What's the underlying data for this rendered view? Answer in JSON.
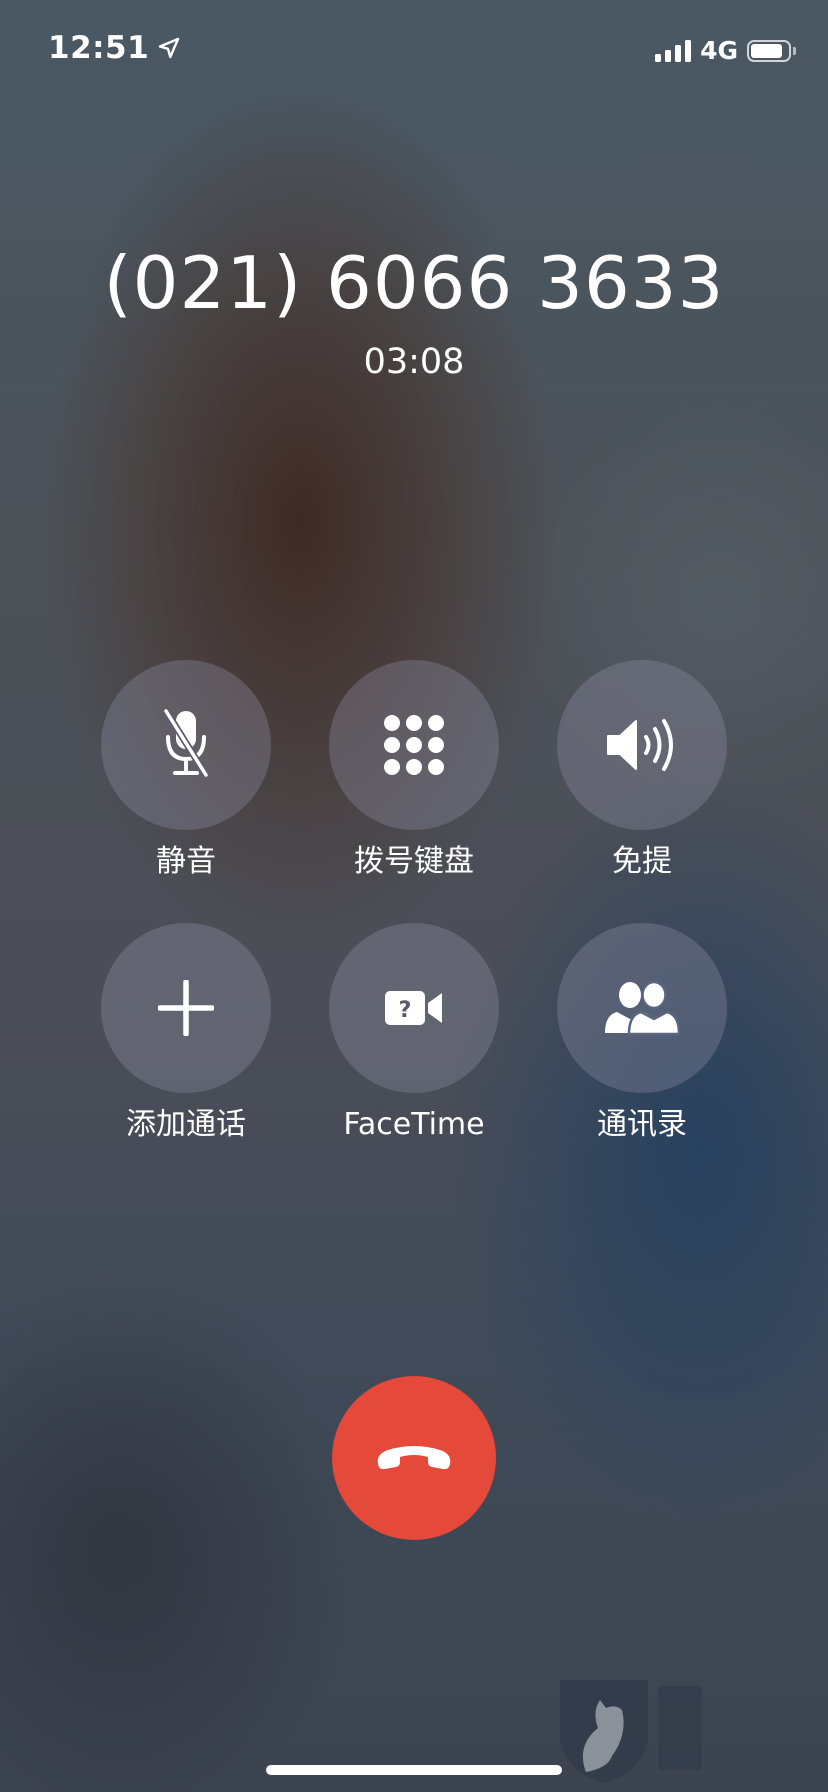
{
  "status_bar": {
    "time": "12:51",
    "network": "4G",
    "battery_level": 0.85,
    "signal_bars": 4
  },
  "call": {
    "caller": "(021) 6066 3633",
    "duration": "03:08"
  },
  "controls": [
    {
      "label": "静音",
      "icon": "mic-off-icon"
    },
    {
      "label": "拨号键盘",
      "icon": "keypad-icon"
    },
    {
      "label": "免提",
      "icon": "speaker-icon"
    },
    {
      "label": "添加通话",
      "icon": "plus-icon"
    },
    {
      "label": "FaceTime",
      "icon": "facetime-unknown-icon"
    },
    {
      "label": "通讯录",
      "icon": "contacts-icon"
    }
  ],
  "end_call": {
    "icon": "end-call-icon",
    "color": "#e5493a"
  },
  "colors": {
    "end_call": "#e5493a",
    "text": "#ffffff"
  }
}
